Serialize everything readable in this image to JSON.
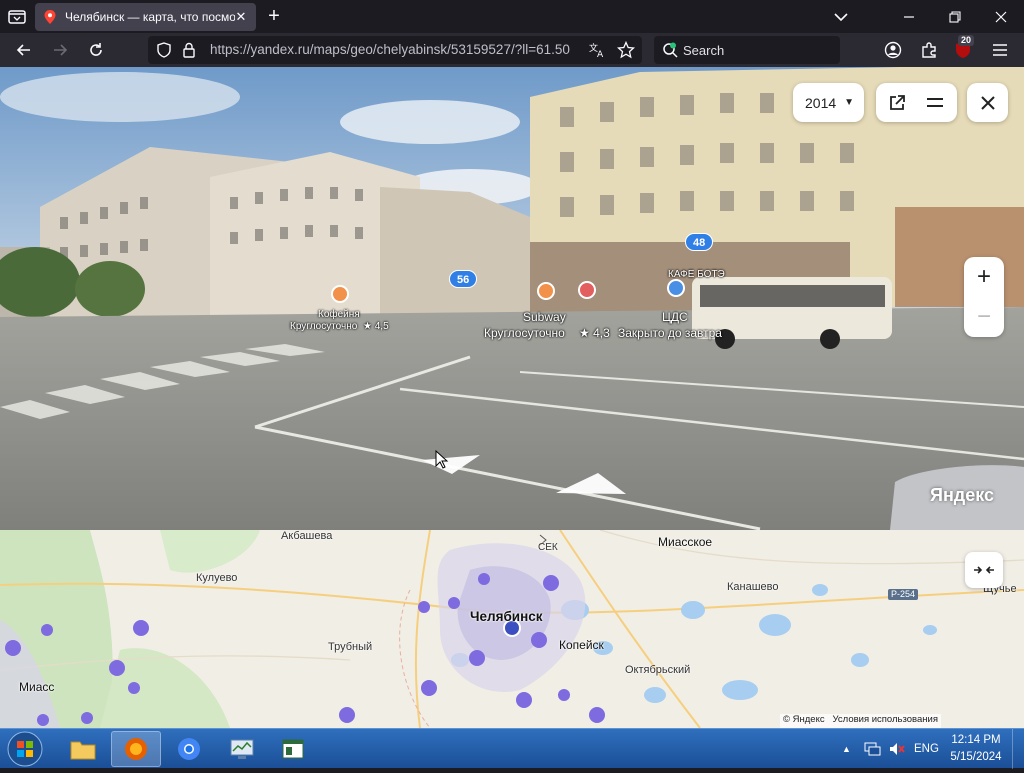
{
  "browser": {
    "tab": {
      "title": "Челябинск — карта, что посмотреть"
    },
    "url": "https://yandex.ru/maps/geo/chelyabinsk/53159527/?ll=61.50",
    "search_placeholder": "Search",
    "extensions_badge": "20"
  },
  "panorama": {
    "year": "2014",
    "bus_stops": [
      "56",
      "48"
    ],
    "labels": {
      "poi_left_name": "Кофейня",
      "poi_left_hours": "Круглосуточно",
      "poi_left_rating": "★ 4,5",
      "poi_center_name": "Subway",
      "poi_center_hours": "Круглосуточно",
      "poi_center_rating": "★ 4,3",
      "poi_right_name": "ЦДС",
      "poi_right_status": "Закрыто до завтра",
      "poi_upper_name": "КАФЕ БОТЭ"
    },
    "watermark": "Яндекс"
  },
  "map": {
    "towns": {
      "akbasheva": "Акбашева",
      "sek": "СЕК",
      "miasskoe": "Миасское",
      "kuluevo": "Кулуево",
      "kanashevo": "Канашево",
      "shuche": "Щучье",
      "chelyabinsk": "Челябинск",
      "kopeysk": "Копейск",
      "trubny": "Трубный",
      "oktyabrsky": "Октябрьский",
      "miass": "Миасс"
    },
    "road": "Р-254",
    "copyright": "© Яндекс",
    "terms": "Условия использования"
  },
  "taskbar": {
    "language": "ENG",
    "time": "12:14 PM",
    "date": "5/15/2024"
  }
}
